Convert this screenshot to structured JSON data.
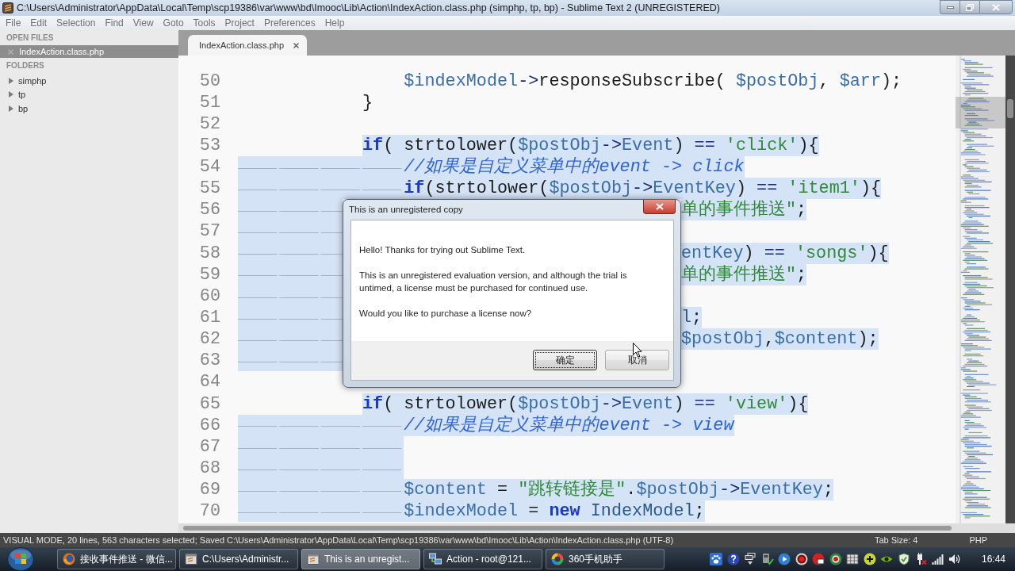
{
  "window": {
    "title": "C:\\Users\\Administrator\\AppData\\Local\\Temp\\scp19386\\var\\www\\bd\\Imooc\\Lib\\Action\\IndexAction.class.php (simphp, tp, bp) - Sublime Text 2 (UNREGISTERED)"
  },
  "menu": [
    "File",
    "Edit",
    "Selection",
    "Find",
    "View",
    "Goto",
    "Tools",
    "Project",
    "Preferences",
    "Help"
  ],
  "sidebar": {
    "open_files": {
      "header": "OPEN FILES",
      "items": [
        {
          "label": "IndexAction.class.php",
          "selected": true
        }
      ]
    },
    "folders": {
      "header": "FOLDERS",
      "items": [
        {
          "label": "simphp",
          "expanded": false
        },
        {
          "label": "tp",
          "expanded": false
        },
        {
          "label": "bp",
          "expanded": false
        }
      ]
    }
  },
  "tabs": [
    {
      "label": "IndexAction.class.php",
      "selected": true
    }
  ],
  "editor": {
    "lines": [
      {
        "number": "50",
        "selected": false,
        "code": [
          {
            "kind": "variable",
            "text": "\t\t\t\t$indexModel"
          },
          {
            "kind": "operator",
            "text": "->"
          },
          {
            "kind": "plain",
            "text": "responseSubscribe( "
          },
          {
            "kind": "variable",
            "text": "$postObj"
          },
          {
            "kind": "plain",
            "text": ", "
          },
          {
            "kind": "variable",
            "text": "$arr"
          },
          {
            "kind": "plain",
            "text": ");"
          }
        ]
      },
      {
        "number": "51",
        "selected": false,
        "code": [
          {
            "kind": "plain",
            "text": "\t\t\t}"
          }
        ]
      },
      {
        "number": "52",
        "selected": false
      },
      {
        "number": "53",
        "selected": true,
        "code": [
          {
            "kind": "keyword",
            "text": "            if"
          },
          {
            "kind": "plain",
            "text": "( strtolower("
          },
          {
            "kind": "variable",
            "text": "$postObj"
          },
          {
            "kind": "operator",
            "text": "->"
          },
          {
            "kind": "variable",
            "text": "Event"
          },
          {
            "kind": "plain",
            "text": ") "
          },
          {
            "kind": "operator",
            "text": "== "
          },
          {
            "kind": "string",
            "text": "'click'"
          },
          {
            "kind": "plain",
            "text": "){"
          }
        ]
      },
      {
        "number": "54",
        "selected": true,
        "code": [
          {
            "kind": "comment",
            "text": "\t\t\t\t//如果是自定义菜单中的event -> click"
          }
        ]
      },
      {
        "number": "55",
        "selected": true,
        "code": [
          {
            "kind": "keyword",
            "text": "\t\t\t\tif"
          },
          {
            "kind": "plain",
            "text": "(strtolower("
          },
          {
            "kind": "variable",
            "text": "$postObj"
          },
          {
            "kind": "operator",
            "text": "->"
          },
          {
            "kind": "variable",
            "text": "EventKey"
          },
          {
            "kind": "plain",
            "text": ") "
          },
          {
            "kind": "operator",
            "text": "== "
          },
          {
            "kind": "string",
            "text": "'item1'"
          },
          {
            "kind": "plain",
            "text": "){"
          }
        ]
      },
      {
        "number": "56",
        "selected": true,
        "covered": true,
        "code": [
          {
            "kind": "string",
            "text": "单的事件推送\""
          },
          {
            "kind": "plain",
            "text": ";"
          }
        ]
      },
      {
        "number": "57",
        "selected": true,
        "covered": true
      },
      {
        "number": "58",
        "selected": true,
        "covered": true,
        "code": [
          {
            "kind": "variable",
            "text": "entKey"
          },
          {
            "kind": "plain",
            "text": ") "
          },
          {
            "kind": "operator",
            "text": "== "
          },
          {
            "kind": "string",
            "text": "'songs'"
          },
          {
            "kind": "plain",
            "text": "){"
          }
        ]
      },
      {
        "number": "59",
        "selected": true,
        "covered": true,
        "code": [
          {
            "kind": "string",
            "text": "单的事件推送\""
          },
          {
            "kind": "plain",
            "text": ";"
          }
        ]
      },
      {
        "number": "60",
        "selected": true,
        "covered": true
      },
      {
        "number": "61",
        "selected": true,
        "covered": true,
        "code": [
          {
            "kind": "class",
            "text": "l"
          },
          {
            "kind": "plain",
            "text": ";"
          }
        ]
      },
      {
        "number": "62",
        "selected": true,
        "covered": true,
        "code": [
          {
            "kind": "variable",
            "text": "$postObj"
          },
          {
            "kind": "plain",
            "text": ","
          },
          {
            "kind": "variable",
            "text": "$content"
          },
          {
            "kind": "plain",
            "text": ");"
          }
        ]
      },
      {
        "number": "63",
        "selected": true,
        "covered": true
      },
      {
        "number": "64",
        "selected": false
      },
      {
        "number": "65",
        "selected": true,
        "code": [
          {
            "kind": "keyword",
            "text": "            if"
          },
          {
            "kind": "plain",
            "text": "( strtolower("
          },
          {
            "kind": "variable",
            "text": "$postObj"
          },
          {
            "kind": "operator",
            "text": "->"
          },
          {
            "kind": "variable",
            "text": "Event"
          },
          {
            "kind": "plain",
            "text": ") "
          },
          {
            "kind": "operator",
            "text": "== "
          },
          {
            "kind": "string",
            "text": "'view'"
          },
          {
            "kind": "plain",
            "text": "){"
          }
        ]
      },
      {
        "number": "66",
        "selected": true,
        "code": [
          {
            "kind": "comment",
            "text": "\t\t\t\t//如果是自定义菜单中的event -> view"
          }
        ]
      },
      {
        "number": "67",
        "selected": true
      },
      {
        "number": "68",
        "selected": true
      },
      {
        "number": "69",
        "selected": true,
        "code": [
          {
            "kind": "variable",
            "text": "\t\t\t\t$content"
          },
          {
            "kind": "plain",
            "text": " = "
          },
          {
            "kind": "string",
            "text": "\"跳转链接是\""
          },
          {
            "kind": "plain",
            "text": "."
          },
          {
            "kind": "variable",
            "text": "$postObj"
          },
          {
            "kind": "operator",
            "text": "->"
          },
          {
            "kind": "variable",
            "text": "EventKey"
          },
          {
            "kind": "plain",
            "text": ";"
          }
        ]
      },
      {
        "number": "70",
        "selected": true,
        "code": [
          {
            "kind": "variable",
            "text": "\t\t\t\t$indexModel"
          },
          {
            "kind": "plain",
            "text": " = "
          },
          {
            "kind": "keyword",
            "text": "new"
          },
          {
            "kind": "class",
            "text": " IndexModel"
          },
          {
            "kind": "plain",
            "text": ";"
          }
        ]
      }
    ]
  },
  "dialog": {
    "title": "This is an unregistered copy",
    "paragraphs": [
      "Hello! Thanks for trying out Sublime Text.",
      "This is an unregistered evaluation version, and although the trial is untimed, a license must be purchased for continued use.",
      "Would you like to purchase a license now?"
    ],
    "buttons": [
      {
        "label": "确定",
        "focused": true
      },
      {
        "label": "取消",
        "focused": false
      }
    ]
  },
  "status_bar": {
    "message": "VISUAL MODE, 20 lines, 563 characters selected; Saved C:\\Users\\Administrator\\AppData\\Local\\Temp\\scp19386\\var\\www\\bd\\Imooc\\Lib\\Action\\IndexAction.class.php (UTF-8)",
    "tab_size": "Tab Size: 4",
    "syntax": "PHP"
  },
  "taskbar": {
    "items": [
      {
        "label": "接收事件推送 - 微信...",
        "kind": "browser",
        "selected": false
      },
      {
        "label": "C:\\Users\\Administr...",
        "kind": "window",
        "selected": false
      },
      {
        "label": "This is an unregist...",
        "kind": "window",
        "selected": true
      },
      {
        "label": "Action - root@121...",
        "kind": "network",
        "selected": false
      },
      {
        "label": "360手机助手",
        "kind": "ring",
        "selected": false
      }
    ],
    "clock": "16:44"
  }
}
